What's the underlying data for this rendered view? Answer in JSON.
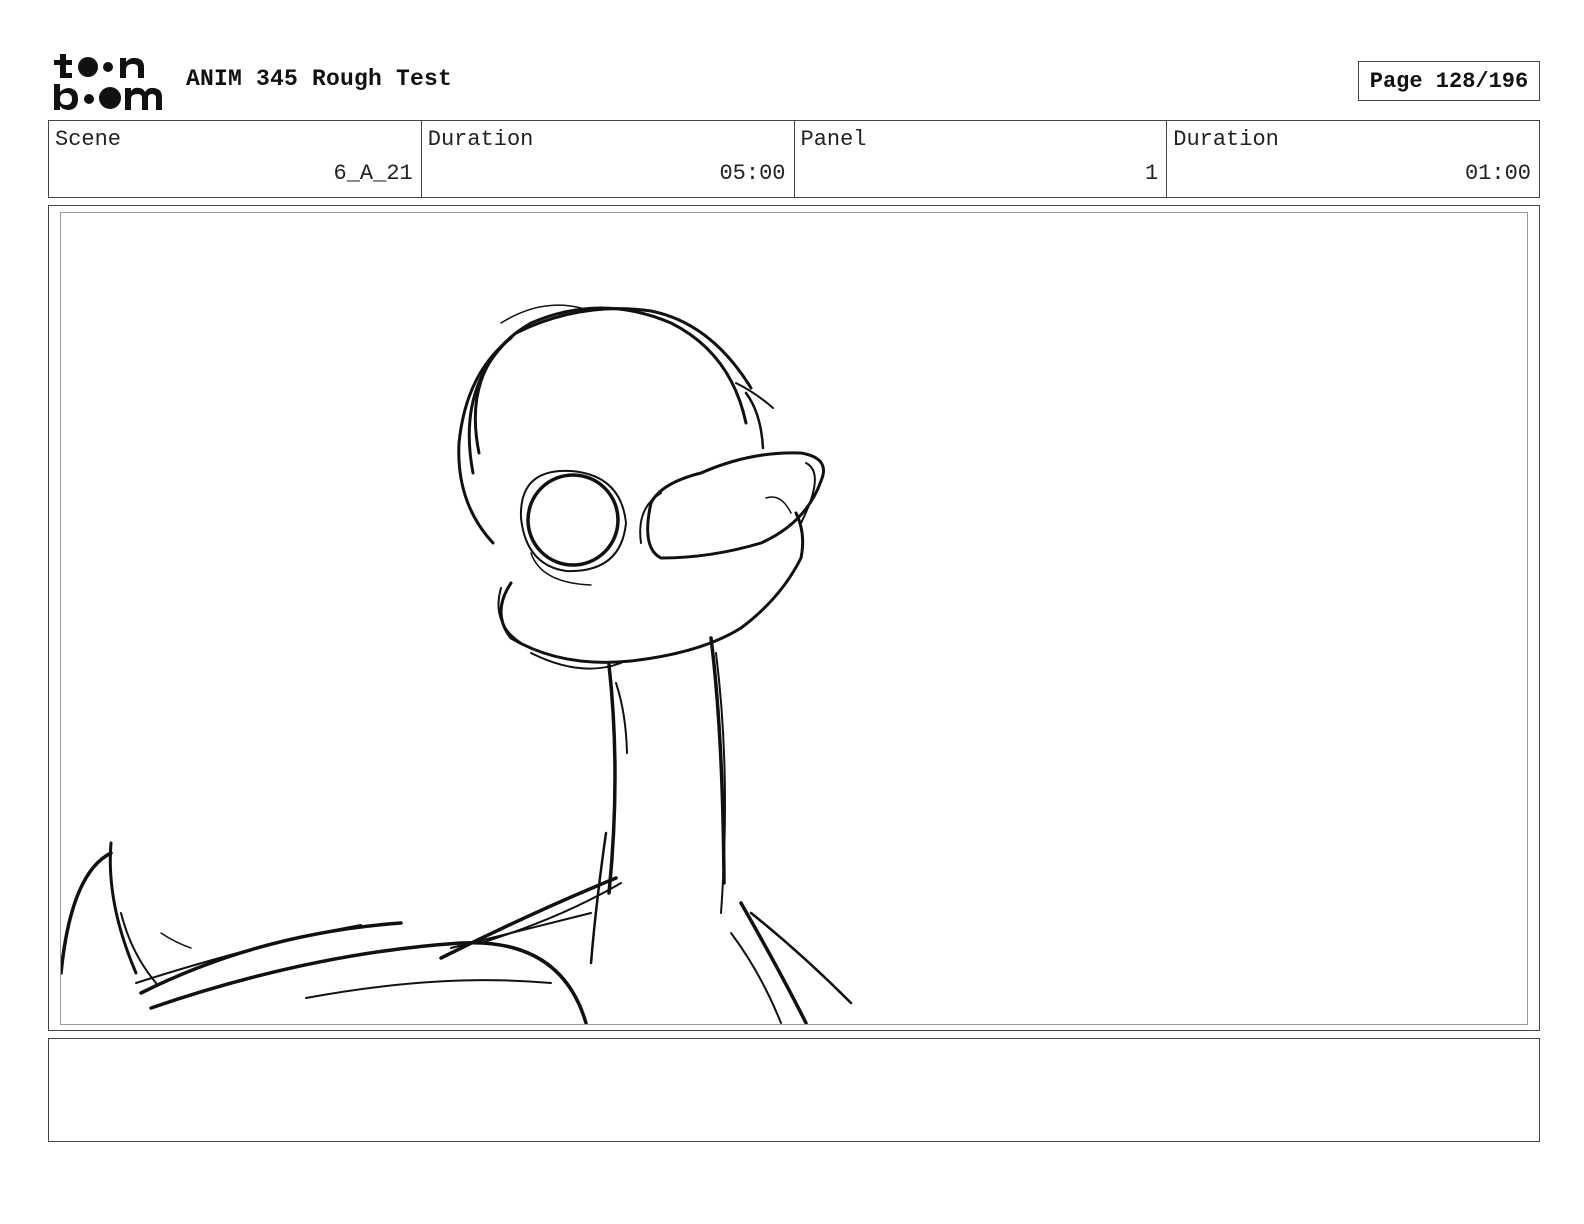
{
  "header": {
    "logo_text": "toon boom",
    "project_title": "ANIM 345 Rough Test",
    "page_label": "Page 128/196"
  },
  "info": [
    {
      "label": "Scene",
      "value": "6_A_21"
    },
    {
      "label": "Duration",
      "value": "05:00"
    },
    {
      "label": "Panel",
      "value": "1"
    },
    {
      "label": "Duration",
      "value": "01:00"
    }
  ],
  "notes": {
    "text": ""
  },
  "icons": {
    "logo": "toon-boom-logo"
  }
}
